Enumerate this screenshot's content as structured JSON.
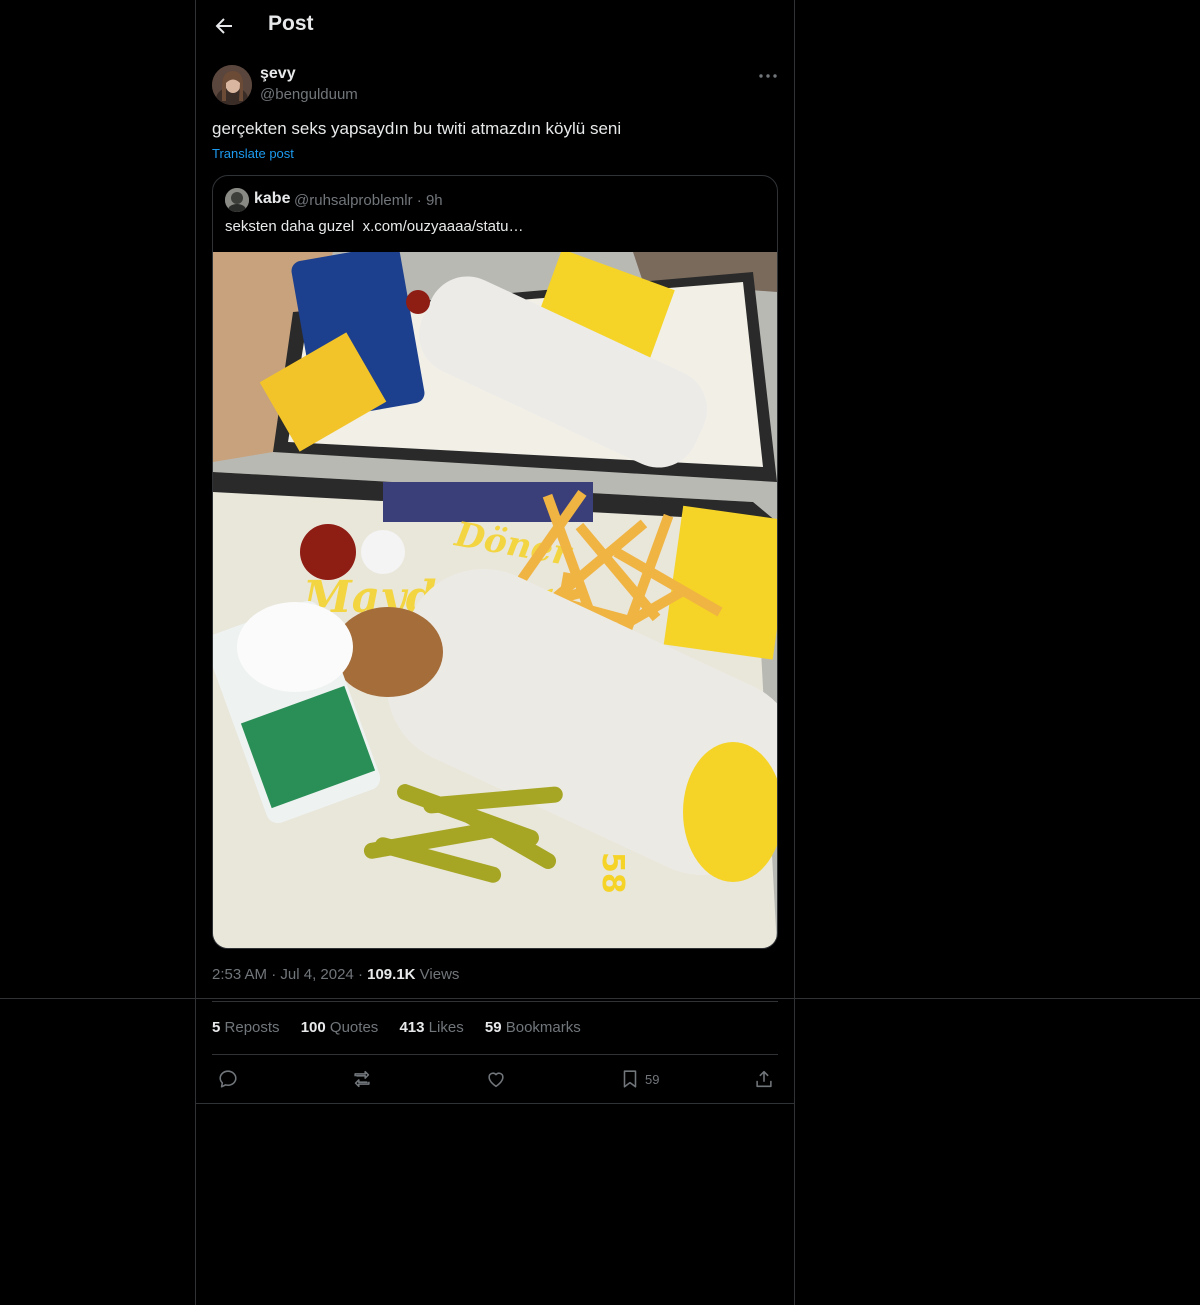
{
  "header": {
    "title": "Post"
  },
  "author": {
    "display_name": "şevy",
    "handle": "@bengulduum"
  },
  "post": {
    "text": "gerçekten seks yapsaydın bu twiti atmazdın köylü seni",
    "translate_label": "Translate post"
  },
  "quote": {
    "name": "kabe",
    "handle": "@ruhsalproblemlr",
    "separator": "·",
    "time": "9h",
    "text": "seksten daha guzel",
    "link": "x.com/ouzyaaaa/statu…",
    "media_signage": {
      "brand": "Maydonoz",
      "product": "Döner",
      "tray_number": "58"
    }
  },
  "meta": {
    "time": "2:53 AM",
    "date": "Jul 4, 2024",
    "separator": "·",
    "views_count": "109.1K",
    "views_label": "Views"
  },
  "stats": [
    {
      "count": "5",
      "label": "Reposts"
    },
    {
      "count": "100",
      "label": "Quotes"
    },
    {
      "count": "413",
      "label": "Likes"
    },
    {
      "count": "59",
      "label": "Bookmarks"
    }
  ],
  "actions": {
    "reply_icon": "reply-icon",
    "repost_icon": "repost-icon",
    "like_icon": "heart-icon",
    "bookmark_icon": "bookmark-icon",
    "bookmark_count": "59",
    "share_icon": "share-icon"
  },
  "colors": {
    "background": "#000000",
    "text": "#e7e9ea",
    "muted": "#71767b",
    "accent": "#1d9bf0",
    "border": "#2f3336"
  }
}
